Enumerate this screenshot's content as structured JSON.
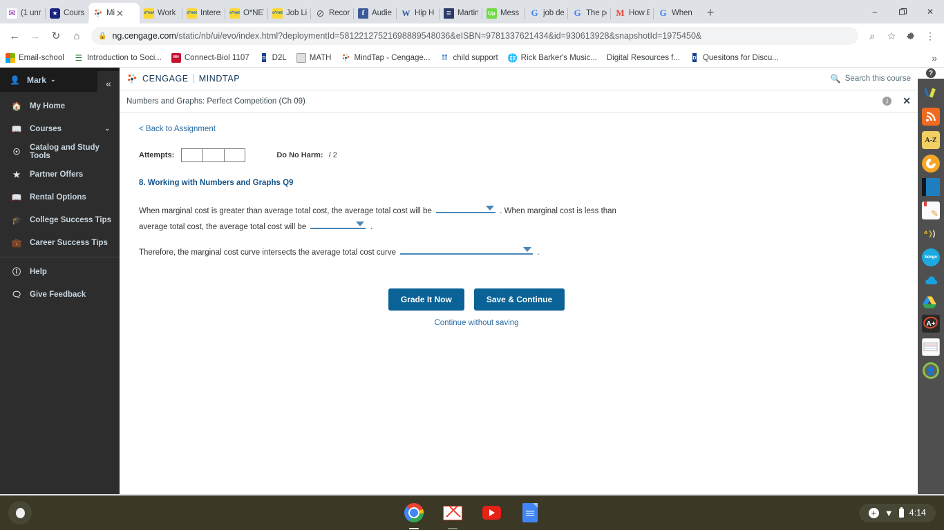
{
  "browser": {
    "tabs": [
      {
        "title": "(1 unr",
        "icon": "mail-icon",
        "active": false
      },
      {
        "title": "Cours",
        "icon": "shield-icon",
        "active": false
      },
      {
        "title": "Mi",
        "icon": "mindtap-icon",
        "active": true
      },
      {
        "title": "Work ",
        "icon": "onet-icon",
        "active": false
      },
      {
        "title": "Interes",
        "icon": "onet-icon",
        "active": false
      },
      {
        "title": "O*NET",
        "icon": "onet-icon",
        "active": false
      },
      {
        "title": "Job Li",
        "icon": "onet-icon",
        "active": false
      },
      {
        "title": "Recor",
        "icon": "circle-slash-icon",
        "active": false
      },
      {
        "title": "Audie",
        "icon": "facebook-icon",
        "active": false
      },
      {
        "title": "Hip H",
        "icon": "word-icon",
        "active": false
      },
      {
        "title": "Martin",
        "icon": "book-icon",
        "active": false
      },
      {
        "title": "Mess",
        "icon": "upwork-icon",
        "active": false
      },
      {
        "title": "job de",
        "icon": "google-icon",
        "active": false
      },
      {
        "title": "The pe",
        "icon": "google-icon",
        "active": false
      },
      {
        "title": "How E",
        "icon": "gmail-icon",
        "active": false
      },
      {
        "title": "When",
        "icon": "google-icon",
        "active": false
      }
    ],
    "new_tab_label": "+",
    "window_controls": {
      "minimize": "–",
      "maximize": "❐",
      "close": "✕"
    },
    "nav": {
      "back": "←",
      "forward": "→",
      "reload": "↻",
      "home": "⌂"
    },
    "url": {
      "lock": "🔒",
      "host": "ng.cengage.com",
      "path": "/static/nb/ui/evo/index.html?deploymentId=58122127521698889548036&eISBN=9781337621434&id=930613928&snapshotId=1975450&"
    },
    "omnibox_actions": {
      "zoom": "⌕",
      "bookmark": "☆",
      "extensions": "❖",
      "menu": "⋮"
    },
    "bookmarks": [
      {
        "label": "Email-school",
        "icon": "windows-icon"
      },
      {
        "label": "Introduction to Soci...",
        "icon": "books-icon"
      },
      {
        "label": "Connect-Biol 1107",
        "icon": "mcgrawhill-icon"
      },
      {
        "label": "D2L",
        "icon": "d2l-icon"
      },
      {
        "label": "MATH",
        "icon": "book-grey-icon"
      },
      {
        "label": "MindTap - Cengage...",
        "icon": "mindtap-icon"
      },
      {
        "label": "child support",
        "icon": "hhs-icon"
      },
      {
        "label": "Rick Barker's Music...",
        "icon": "globe-icon"
      },
      {
        "label": "Digital Resources f...",
        "icon": "none"
      },
      {
        "label": "Quesitons for Discu...",
        "icon": "d2l-icon"
      }
    ],
    "bookmarks_overflow": "»"
  },
  "sidebar": {
    "user": {
      "name": "Mark",
      "icon": "user-icon",
      "caret": "⌄"
    },
    "collapse_icon": "«",
    "items": [
      {
        "label": "My Home",
        "icon": "home-icon",
        "chevron": ""
      },
      {
        "label": "Courses",
        "icon": "courses-icon",
        "chevron": "⌄"
      },
      {
        "label": "Catalog and Study Tools",
        "icon": "compass-icon",
        "chevron": ""
      },
      {
        "label": "Partner Offers",
        "icon": "star-icon",
        "chevron": ""
      },
      {
        "label": "Rental Options",
        "icon": "open-book-icon",
        "chevron": ""
      },
      {
        "label": "College Success Tips",
        "icon": "graduation-cap-icon",
        "chevron": ""
      },
      {
        "label": "Career Success Tips",
        "icon": "briefcase-icon",
        "chevron": ""
      }
    ],
    "footer_items": [
      {
        "label": "Help",
        "icon": "question-circle-icon"
      },
      {
        "label": "Give Feedback",
        "icon": "feedback-icon"
      }
    ]
  },
  "app_header": {
    "brand_primary": "CENGAGE",
    "brand_secondary": "MINDTAP",
    "search_label": "Search this course",
    "search_icon": "search-icon"
  },
  "subheader": {
    "title": "Numbers and Graphs: Perfect Competition (Ch 09)",
    "info_icon": "i",
    "close_icon": "✕"
  },
  "main": {
    "back_link": "< Back to Assignment",
    "attempts_label": "Attempts:",
    "attempt_boxes": [
      "",
      "",
      ""
    ],
    "score_label": "Do No Harm:",
    "score_value": "/ 2",
    "question_title": "8. Working with Numbers and Graphs Q9",
    "paragraph1_part1": "When marginal cost is greater than average total cost, the average total cost will be",
    "dropdown1_value": "",
    "paragraph1_part2": ". When marginal cost is less than average total cost, the average total cost will be",
    "dropdown2_value": "",
    "paragraph1_part3": ".",
    "paragraph2_part1": "Therefore, the marginal cost curve intersects the average total cost curve",
    "dropdown3_value": "",
    "paragraph2_part2": ".",
    "grade_button": "Grade It Now",
    "save_button": "Save & Continue",
    "continue_link": "Continue without saving"
  },
  "rail": {
    "help_icon": "?",
    "icons": [
      {
        "name": "highlighter-pen-icon",
        "glyph": "✏"
      },
      {
        "name": "rss-icon",
        "glyph": "◖"
      },
      {
        "name": "a-z-dictionary-icon",
        "glyph": "A-Z"
      },
      {
        "name": "bing-icon",
        "glyph": "b"
      },
      {
        "name": "blue-book-icon",
        "glyph": ""
      },
      {
        "name": "notepad-pencil-icon",
        "glyph": ""
      },
      {
        "name": "read-aloud-icon",
        "glyph": "♪"
      },
      {
        "name": "bongo-icon",
        "glyph": "bongo"
      },
      {
        "name": "onedrive-cloud-icon",
        "glyph": "☁"
      },
      {
        "name": "google-drive-icon",
        "glyph": ""
      },
      {
        "name": "a-plus-grade-icon",
        "glyph": "A+"
      },
      {
        "name": "index-cards-icon",
        "glyph": ""
      },
      {
        "name": "profile-avatar-icon",
        "glyph": "●"
      }
    ]
  },
  "shelf": {
    "launcher_icon": "launcher-icon",
    "apps": [
      {
        "name": "chrome-icon",
        "running": true
      },
      {
        "name": "gmail-icon",
        "running": true
      },
      {
        "name": "youtube-icon",
        "running": false
      },
      {
        "name": "google-docs-icon",
        "running": false
      }
    ],
    "tray": {
      "plus_icon": "+",
      "wifi_icon": "▼",
      "battery_icon": "battery-icon",
      "time": "4:14"
    }
  },
  "colors": {
    "accent_blue": "#0a6296",
    "link_blue": "#2d6ca2",
    "dropdown_blue": "#4a86b8",
    "question_title": "#14548c",
    "sidebar_bg": "#2d2d2d",
    "rail_bg": "#4f4f4f",
    "shelf_bg": "#3b3826"
  }
}
